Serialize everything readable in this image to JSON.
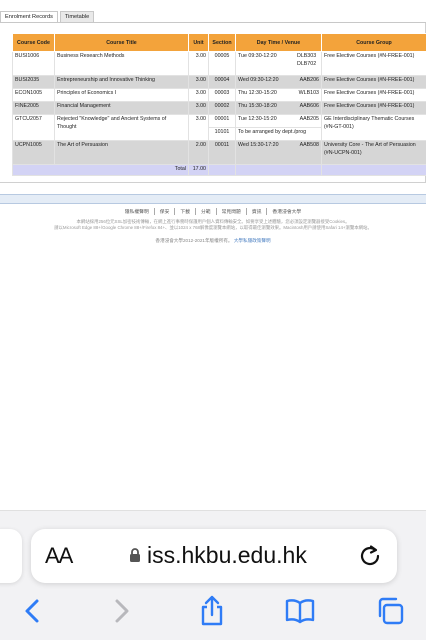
{
  "tabs": [
    {
      "label": "Enrolment Records"
    },
    {
      "label": "Timetable"
    }
  ],
  "table": {
    "headers": [
      "Course Code",
      "Course Title",
      "Unit",
      "Section",
      "Day Time / Venue",
      "Course Group"
    ],
    "rows": [
      {
        "code": "BUSI1006",
        "title": "Business Research Methods",
        "unit": "3.00",
        "section": "00005",
        "time": "Tue 09:30-12:20",
        "venue": "DLB303 DLB702",
        "group": "Free Elective Courses (#N-FREE-001)"
      },
      {
        "code": "BUSI2035",
        "title": "Entrepreneurship and Innovative Thinking",
        "unit": "3.00",
        "section": "00004",
        "time": "Wed 09:30-12:20",
        "venue": "AAB206",
        "group": "Free Elective Courses (#N-FREE-001)"
      },
      {
        "code": "ECON1005",
        "title": "Principles of Economics I",
        "unit": "3.00",
        "section": "00003",
        "time": "Thu 12:30-15:20",
        "venue": "WLB103",
        "group": "Free Elective Courses (#N-FREE-001)"
      },
      {
        "code": "FINE2005",
        "title": "Financial Management",
        "unit": "3.00",
        "section": "00002",
        "time": "Thu 15:30-18:20",
        "venue": "AAB606",
        "group": "Free Elective Courses (#N-FREE-001)"
      },
      {
        "code": "GTCU2057",
        "title": "Rejected \"Knowledge\" and Ancient Systems of Thought",
        "unit": "3.00",
        "section": "00001",
        "time": "Tue 12:30-15:20",
        "venue": "AAB205",
        "section2": "10101",
        "time2": "To be arranged by dept./prog",
        "group": "GE Interdisciplinary Thematic Courses (#N-GT-001)"
      },
      {
        "code": "UCPN1005",
        "title": "The Art of Persuasion",
        "unit": "2.00",
        "section": "00011",
        "time": "Wed 15:30-17:20",
        "venue": "AAB508",
        "group": "University Core - The Art of Persuasion (#N-UCPN-001)"
      }
    ],
    "total_label": "Total",
    "total_value": "17.00"
  },
  "footer": {
    "links": [
      "隱私權聲明",
      "保安",
      "下載",
      "分範",
      "常見問題",
      "資訊",
      "香港浸會大學"
    ],
    "notice_1": "本網站採用256位元SSL加密技術傳輸，在網上進行事務時保護用戶個人資料傳輸安全。如要享受上述體驗，您必須設定瀏覽器接受Cookies。",
    "notice_2": "請以Microsoft Edge 88+/Google Chrome 88+/Firefox 84+、並以1024 x 768解像度瀏覽本網站，以取得最佳瀏覽效果。Macintosh用戶請使用Safari 14+瀏覽本網站。",
    "copyright": "香港浸會大學2012-2021年版權所有。",
    "privacy_link": "大學私隱政策聲明"
  },
  "browser": {
    "aa_label": "AA",
    "url": "iss.hkbu.edu.hk"
  },
  "colors": {
    "header_orange": "#f3a33b",
    "row_gray": "#d6d6d6",
    "total_row": "#d3d3f5",
    "ios_blue": "#2f7cf6"
  }
}
